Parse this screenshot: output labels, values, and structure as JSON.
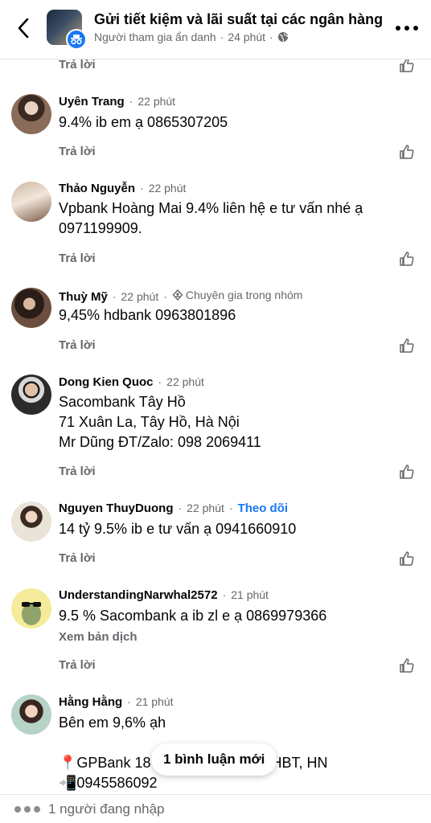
{
  "header": {
    "title": "Gửi tiết kiệm và lãi suất tại các ngân hàng",
    "author": "Người tham gia ẩn danh",
    "separator": "·",
    "time": "24 phút"
  },
  "reply_label": "Trả lời",
  "comments": [
    {
      "name": "Uyên Trang",
      "time": "22 phút",
      "lines": [
        "9.4% ib em ạ 0865307205"
      ]
    },
    {
      "name": "Thảo Nguyễn",
      "time": "22 phút",
      "lines": [
        "Vpbank Hoàng Mai 9.4% liên hệ e tư vấn nhé ạ",
        "0971199909."
      ]
    },
    {
      "name": "Thuỳ Mỹ",
      "time": "22 phút",
      "badge": "Chuyên gia trong nhóm",
      "lines": [
        "9,45% hdbank 0963801896"
      ]
    },
    {
      "name": "Dong Kien Quoc",
      "time": "22 phút",
      "lines": [
        "Sacombank Tây Hồ",
        "71 Xuân La, Tây Hồ, Hà Nội",
        "Mr Dũng ĐT/Zalo: 098 2069411"
      ]
    },
    {
      "name": "Nguyen ThuyDuong",
      "time": "22 phút",
      "follow": "Theo dõi",
      "lines": [
        "14 tỷ 9.5% ib e tư vấn ạ 0941660910"
      ]
    },
    {
      "name": "UnderstandingNarwhal2572",
      "time": "21 phút",
      "lines": [
        "9.5 % Sacombank a ib zl e ạ 0869979366"
      ],
      "translate": "Xem bản dịch"
    },
    {
      "name": "Hằng Hằng",
      "time": "21 phút",
      "lines": [
        "Bên em 9,6% ạh",
        "",
        "📍GPBank 18",
        "📲0945586092"
      ],
      "line3_tail": "HBT, HN"
    }
  ],
  "new_comments_pill": "1 bình luận mới",
  "typing": "1 người đang nhập",
  "colors": {
    "primary": "#1877f2",
    "secondary_text": "#65676b"
  }
}
